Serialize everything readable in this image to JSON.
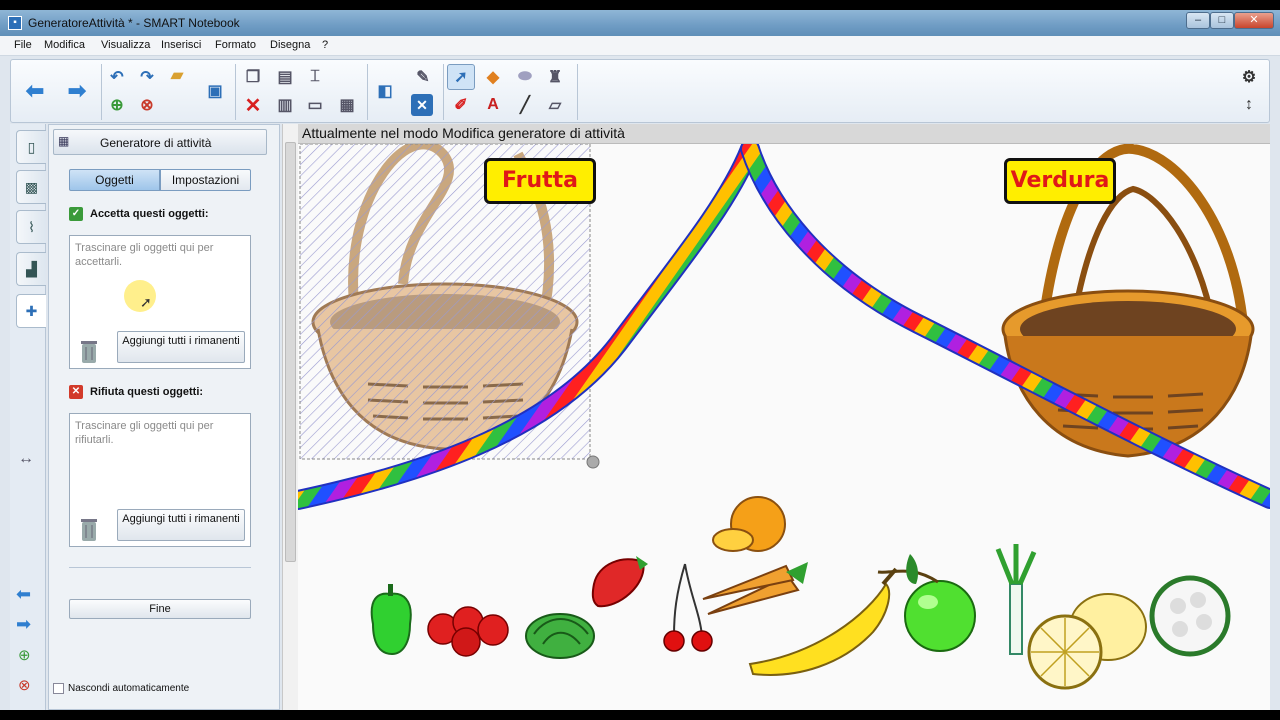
{
  "window": {
    "title": "GeneratoreAttività * - SMART Notebook",
    "app_icon": "notebook-icon",
    "controls": [
      "–",
      "□",
      "✕"
    ]
  },
  "menu": [
    "File",
    "Modifica",
    "Visualizza",
    "Inserisci",
    "Formato",
    "Disegna",
    "?"
  ],
  "panel": {
    "header_title": "Generatore di attività",
    "tabs": [
      {
        "label": "Oggetti",
        "active": true
      },
      {
        "label": "Impostazioni",
        "active": false
      }
    ],
    "accept": {
      "label": "Accetta questi oggetti:",
      "placeholder": "Trascinare gli oggetti qui per accettarli.",
      "button": "Aggiungi tutti i rimanenti"
    },
    "reject": {
      "label": "Rifiuta questi oggetti:",
      "placeholder": "Trascinare gli oggetti qui per rifiutarli.",
      "button": "Aggiungi tutti i rimanenti"
    },
    "finish_button": "Fine",
    "autohide_label": "Nascondi automaticamente"
  },
  "canvas": {
    "mode_banner": "Attualmente nel modo Modifica generatore di attività",
    "labels": {
      "fruit": "Frutta",
      "vegetables": "Verdura"
    }
  },
  "colors": {
    "accent": "#9ec5ea",
    "label_bg": "#ffee00",
    "label_text": "#e01818",
    "accept_check": "#3a9a3a",
    "reject_check": "#d23a2a"
  }
}
